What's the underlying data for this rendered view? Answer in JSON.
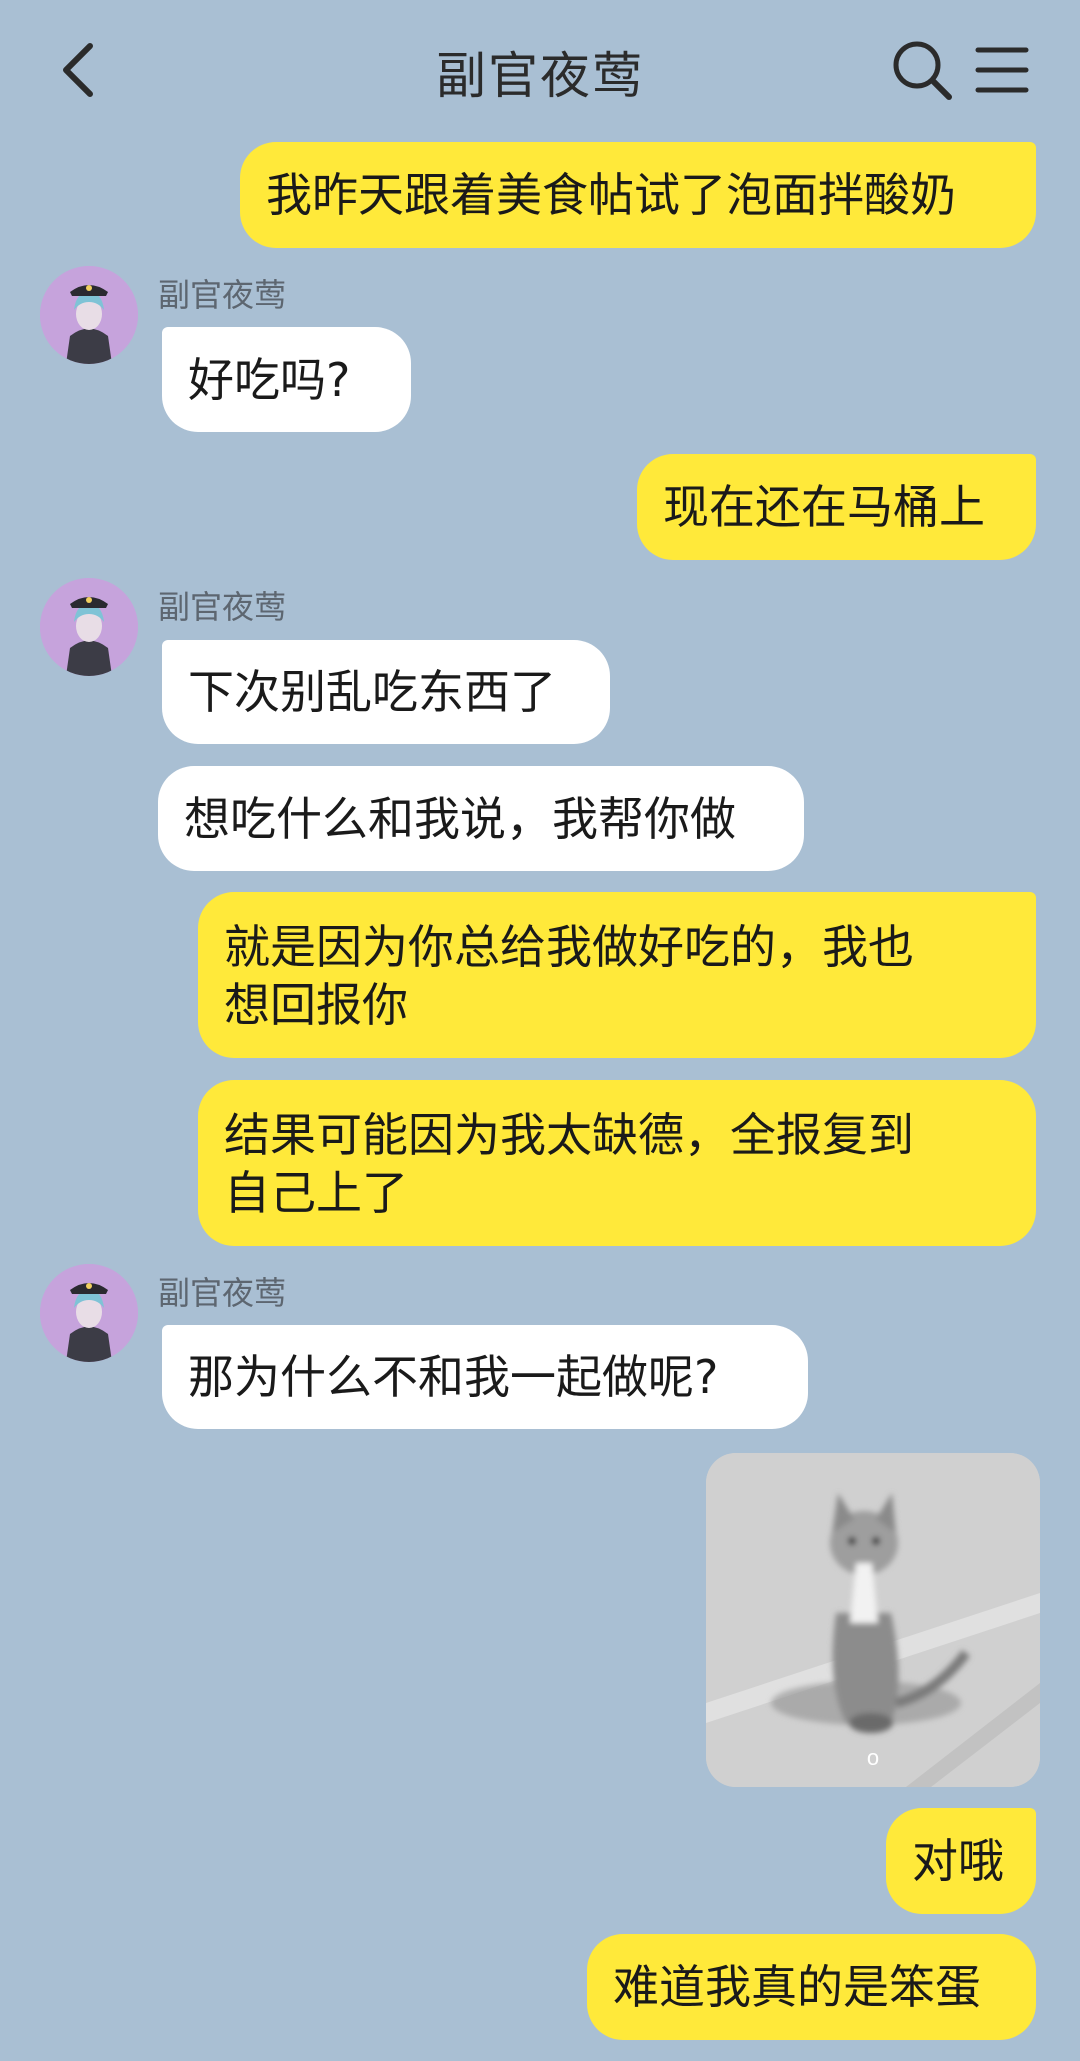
{
  "header": {
    "title": "副官夜莺"
  },
  "contact_name": "副官夜莺",
  "messages": {
    "m1": "我昨天跟着美食帖试了泡面拌酸奶",
    "m2": "好吃吗?",
    "m3": "现在还在马桶上",
    "m4": "下次别乱吃东西了",
    "m5": "想吃什么和我说，我帮你做",
    "m6": "就是因为你总给我做好吃的，我也\n想回报你",
    "m7": "结果可能因为我太缺德，全报复到\n自己上了",
    "m8": "那为什么不和我一起做呢?",
    "m10": "对哦",
    "m11": "难道我真的是笨蛋"
  },
  "sticker": {
    "caption": "o"
  },
  "colors": {
    "background": "#a9bfd3",
    "my_bubble": "#ffe93a",
    "their_bubble": "#ffffff"
  }
}
